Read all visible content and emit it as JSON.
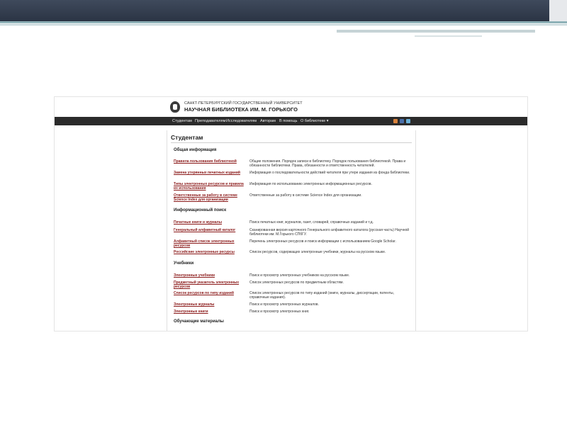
{
  "header": {
    "university": "САНКТ-ПЕТЕРБУРГСКИЙ ГОСУДАРСТВЕННЫЙ УНИВЕРСИТЕТ",
    "library": "НАУЧНАЯ БИБЛИОТЕКА ИМ. М. ГОРЬКОГО"
  },
  "nav": [
    "Студентам",
    "Преподавателям",
    "Исследователям",
    "Авторам",
    "В помощь",
    "О библиотеке ▾"
  ],
  "social_icons": [
    "vk-icon",
    "facebook-icon",
    "twitter-icon"
  ],
  "colors": {
    "link": "#8b1a1a",
    "nav_bg": "#2b2b2b",
    "slide_bar": "#3f4a5c",
    "stripe": "#8fb2b8"
  },
  "page": {
    "title": "Студентам",
    "sections": [
      {
        "heading": "Общая информация",
        "rows": [
          {
            "link": "Правила пользования библиотекой",
            "desc": "Общие положения. Порядок записи в библиотеку. Порядок пользования библиотекой. Права и обязанности библиотеки. Права, обязанности и ответственность читателей."
          },
          {
            "link": "Замена утерянных печатных изданий",
            "desc": "Информация о последовательности действий читателя при утере издания из фонда библиотеки."
          },
          {
            "link": "Типы электронных ресурсов и правила их использования",
            "desc": "Информация по использованию электронных информационных ресурсов."
          },
          {
            "link": "Ответственные за работу в системе Science Index для организации",
            "desc": "Ответственные за работу в системе Science Index для организации."
          }
        ]
      },
      {
        "heading": "Информационный поиск",
        "rows": [
          {
            "link": "Печатные книги и журналы",
            "desc": "Поиск печатных книг, журналов, газет, словарей, справочных изданий и т.д."
          },
          {
            "link": "Генеральный алфавитный каталог",
            "desc": "Сканированная версия карточного Генерального алфавитного каталога (русская часть) Научной библиотеки им. М.Горького СПбГУ."
          },
          {
            "link": "Алфавитный список электронных ресурсов",
            "desc": "Перечень электронных ресурсов и поиск информации с использованием Google Scholar."
          },
          {
            "link": "Российские электронные ресурсы",
            "desc": "Список ресурсов, содержащих электронные учебники, журналы на русском языке."
          }
        ]
      },
      {
        "heading": "Учебники",
        "rows": [
          {
            "link": "Электронные учебники",
            "desc": "Поиск и просмотр электронных учебников на русском языке."
          },
          {
            "link": "Предметный указатель электронных ресурсов",
            "desc": "Список электронных ресурсов по предметным областям."
          },
          {
            "link": "Список ресурсов по типу изданий",
            "desc": "Список электронных ресурсов по типу изданий (книги, журналы, диссертации, патенты, справочные издания)."
          },
          {
            "link": "Электронные журналы",
            "desc": "Поиск и просмотр электронных журналов."
          },
          {
            "link": "Электронные книги",
            "desc": "Поиск и просмотр электронных книг."
          }
        ]
      },
      {
        "heading": "Обучающие материалы",
        "rows": []
      }
    ]
  }
}
